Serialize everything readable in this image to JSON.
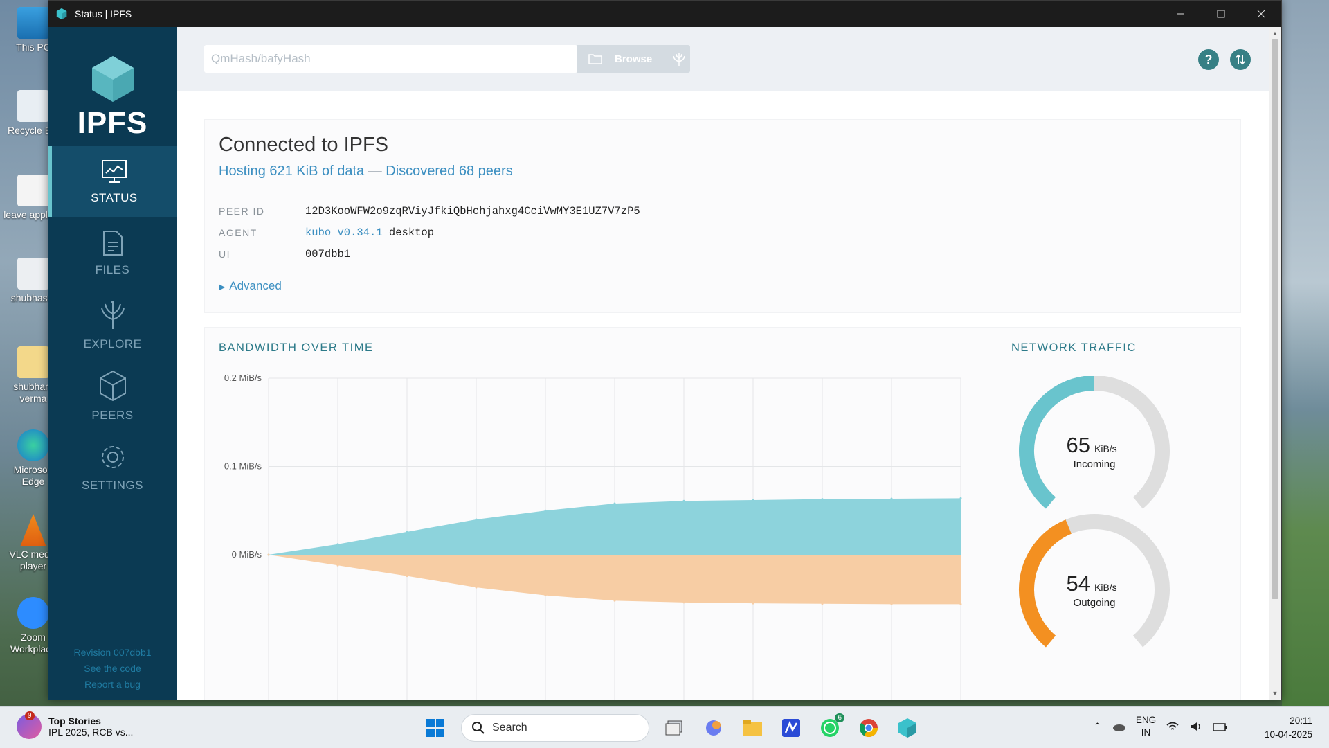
{
  "window": {
    "title": "Status | IPFS",
    "controls": [
      "minimize",
      "maximize",
      "close"
    ]
  },
  "sidebar": {
    "logo": "IPFS",
    "items": [
      {
        "label": "STATUS",
        "icon": "status-icon",
        "active": true
      },
      {
        "label": "FILES",
        "icon": "files-icon",
        "active": false
      },
      {
        "label": "EXPLORE",
        "icon": "explore-icon",
        "active": false
      },
      {
        "label": "PEERS",
        "icon": "peers-icon",
        "active": false
      },
      {
        "label": "SETTINGS",
        "icon": "settings-icon",
        "active": false
      }
    ],
    "footer": {
      "revision": "Revision 007dbb1",
      "code": "See the code",
      "bug": "Report a bug"
    }
  },
  "topbar": {
    "search_placeholder": "QmHash/bafyHash",
    "browse_label": "Browse",
    "help_icon": "?",
    "update_icon": "arrows-updown-icon"
  },
  "status": {
    "title": "Connected to IPFS",
    "hosting": "Hosting 621 KiB of data",
    "separator": "—",
    "peers": "Discovered 68 peers",
    "fields": [
      {
        "key": "PEER ID",
        "value": "12D3KooWFW2o9zqRViyJfkiQbHchjahxg4CciVwMY3E1UZ7V7zP5"
      },
      {
        "key": "AGENT",
        "value_link": "kubo v0.34.1",
        "value_rest": " desktop"
      },
      {
        "key": "UI",
        "value": "007dbb1"
      }
    ],
    "advanced": "Advanced"
  },
  "bandwidth": {
    "title": "BANDWIDTH OVER TIME",
    "traffic_title": "NETWORK TRAFFIC"
  },
  "chart_data": [
    {
      "type": "area",
      "title": "BANDWIDTH OVER TIME",
      "y_ticks": [
        "0.2 MiB/s",
        "0.1 MiB/s",
        "0 MiB/s"
      ],
      "ylim": [
        -0.06,
        0.2
      ],
      "series": [
        {
          "values": [
            0,
            0.012,
            0.026,
            0.04,
            0.05,
            0.058,
            0.061,
            0.062,
            0.063,
            0.0635,
            0.064
          ],
          "color": "#8dd3dc"
        },
        {
          "values": [
            0,
            -0.012,
            -0.024,
            -0.037,
            -0.046,
            -0.052,
            -0.054,
            -0.055,
            -0.0555,
            -0.056,
            -0.056
          ],
          "color": "#f7cda4"
        }
      ],
      "x_count": 11,
      "grid": true
    },
    {
      "type": "gauge",
      "title": "NETWORK TRAFFIC",
      "gauges": [
        {
          "value": 65,
          "unit": "KiB/s",
          "label": "Incoming",
          "fraction": 0.5,
          "color": "#69c4cd"
        },
        {
          "value": 54,
          "unit": "KiB/s",
          "label": "Outgoing",
          "fraction": 0.42,
          "color": "#f39021"
        }
      ]
    }
  ],
  "desktop": {
    "icons": [
      {
        "label": "This PC"
      },
      {
        "label": "Recycle Bin"
      },
      {
        "label": "leave applicat"
      },
      {
        "label": "shubhasm"
      },
      {
        "label": "shubham verma"
      },
      {
        "label": "Microsoft Edge"
      },
      {
        "label": "VLC media player"
      },
      {
        "label": "Zoom Workplace"
      }
    ]
  },
  "taskbar": {
    "news_badge": "9",
    "news_title": "Top Stories",
    "news_sub": "IPL 2025, RCB vs...",
    "search_label": "Search",
    "whatsapp_badge": "6",
    "lang_top": "ENG",
    "lang_bottom": "IN",
    "time": "20:11",
    "date": "10-04-2025"
  }
}
